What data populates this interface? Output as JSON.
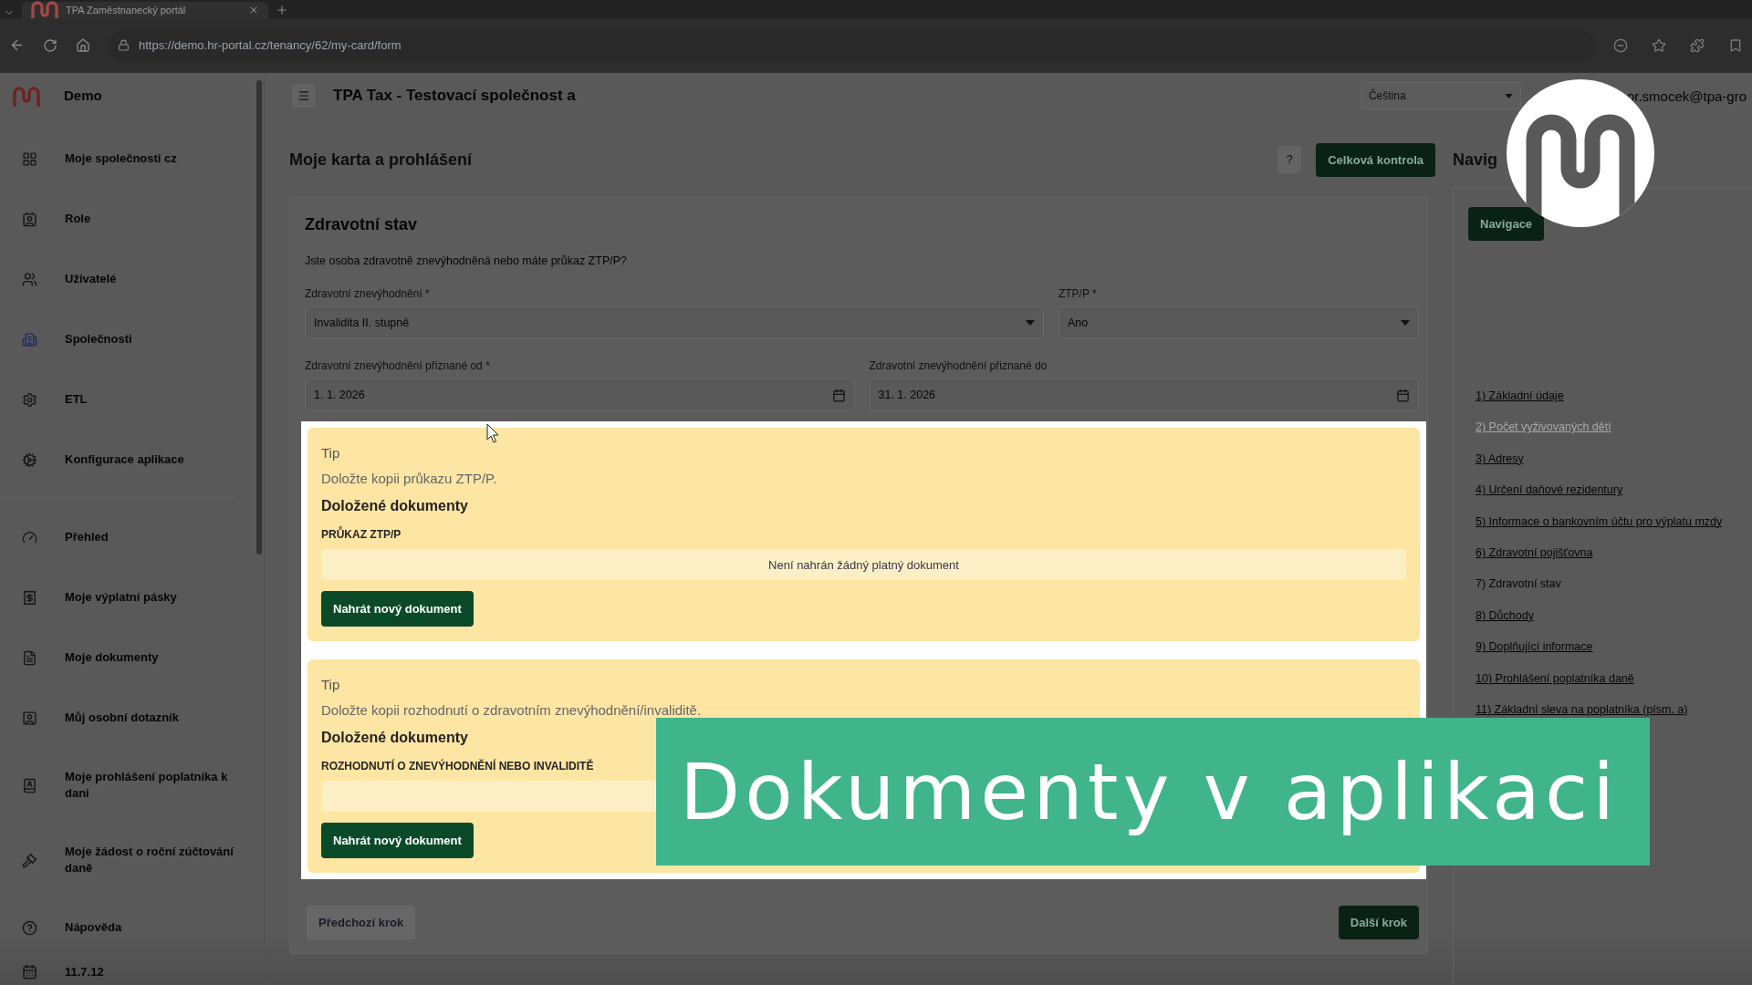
{
  "browser": {
    "tab": {
      "title": "TPA Zaměstnanecký portál"
    },
    "url": "https://demo.hr-portal.cz/tenancy/62/my-card/form"
  },
  "header": {
    "brand": "Demo",
    "title": "TPA Tax - Testovací společnost a",
    "language": "Čeština",
    "user": "or.smocek@tpa-gro"
  },
  "sidebar": {
    "sections": [
      {
        "items": [
          {
            "label": "Moje společnosti cz"
          },
          {
            "label": "Role"
          },
          {
            "label": "Uživatelé"
          },
          {
            "label": "Společnosti"
          },
          {
            "label": "ETL"
          },
          {
            "label": "Konfigurace aplikace"
          }
        ]
      },
      {
        "items": [
          {
            "label": "Přehled"
          },
          {
            "label": "Moje výplatní pásky"
          },
          {
            "label": "Moje dokumenty"
          },
          {
            "label": "Můj osobní dotazník"
          },
          {
            "label": "Moje prohlášení poplatníka k dani"
          },
          {
            "label": "Moje žádost o roční zúčtování daně"
          },
          {
            "label": "Nápověda"
          }
        ]
      }
    ],
    "version": "11.7.12"
  },
  "page": {
    "title": "Moje karta a prohlášení",
    "help_button": "?",
    "check_button": "Celková kontrola"
  },
  "form": {
    "title": "Zdravotní stav",
    "question": "Jste osoba zdravotně znevýhodněná nebo máte průkaz ZTP/P?",
    "rows": [
      [
        {
          "kind": "select",
          "label": "Zdravotní znevýhodnění *",
          "value": "Invalidita II. stupně"
        },
        {
          "kind": "select",
          "label": "ZTP/P *",
          "value": "Ano"
        }
      ],
      [
        {
          "kind": "date",
          "label": "Zdravotní znevýhodnění přiznané od *",
          "value": "1. 1. 2026"
        },
        {
          "kind": "date",
          "label": "Zdravotní znevýhodnění přiznané do",
          "value": "31. 1. 2026"
        }
      ]
    ],
    "tips": [
      {
        "title": "Tip",
        "text": "Doložte kopii průkazu ZTP/P.",
        "documents_heading": "Doložené dokumenty",
        "document_type": "PRŮKAZ ZTP/P",
        "empty_message": "Není nahrán žádný platný dokument",
        "upload_button": "Nahrát nový dokument"
      },
      {
        "title": "Tip",
        "text": "Doložte kopii rozhodnutí o zdravotním znevýhodnění/invaliditě.",
        "documents_heading": "Doložené dokumenty",
        "document_type": "ROZHODNUTÍ O ZNEVÝHODNĚNÍ NEBO INVALIDITĚ",
        "upload_button": "Nahrát nový dokument"
      }
    ],
    "previous_button": {
      "label": "Předchozí krok",
      "disabled": true
    },
    "next_button": {
      "label": "Další krok",
      "disabled": false
    }
  },
  "navigation": {
    "heading": "Navig",
    "tabs": [
      {
        "label": "Navigace",
        "selected": true
      }
    ],
    "items": [
      {
        "label": "1) Základní údaje",
        "selected": false,
        "disabled": false
      },
      {
        "label": "2) Počet vyživovaných dětí",
        "selected": false,
        "disabled": true
      },
      {
        "label": "3) Adresy",
        "selected": false,
        "disabled": false
      },
      {
        "label": "4) Určení daňové rezidentury",
        "selected": false,
        "disabled": false
      },
      {
        "label": "5) Informace o bankovním účtu pro výplatu mzdy",
        "selected": false,
        "disabled": false
      },
      {
        "label": "6) Zdravotní pojišťovna",
        "selected": false,
        "disabled": false
      },
      {
        "label": "7) Zdravotní stav",
        "selected": true,
        "disabled": false
      },
      {
        "label": "8) Důchody",
        "selected": false,
        "disabled": false
      },
      {
        "label": "9) Doplňující informace",
        "selected": false,
        "disabled": false
      },
      {
        "label": "10) Prohlášení poplatníka daně",
        "selected": false,
        "disabled": false
      },
      {
        "label": "11) Základní sleva na poplatníka (písm. a)",
        "selected": false,
        "disabled": false
      }
    ]
  },
  "caption": "Dokumenty v aplikaci"
}
